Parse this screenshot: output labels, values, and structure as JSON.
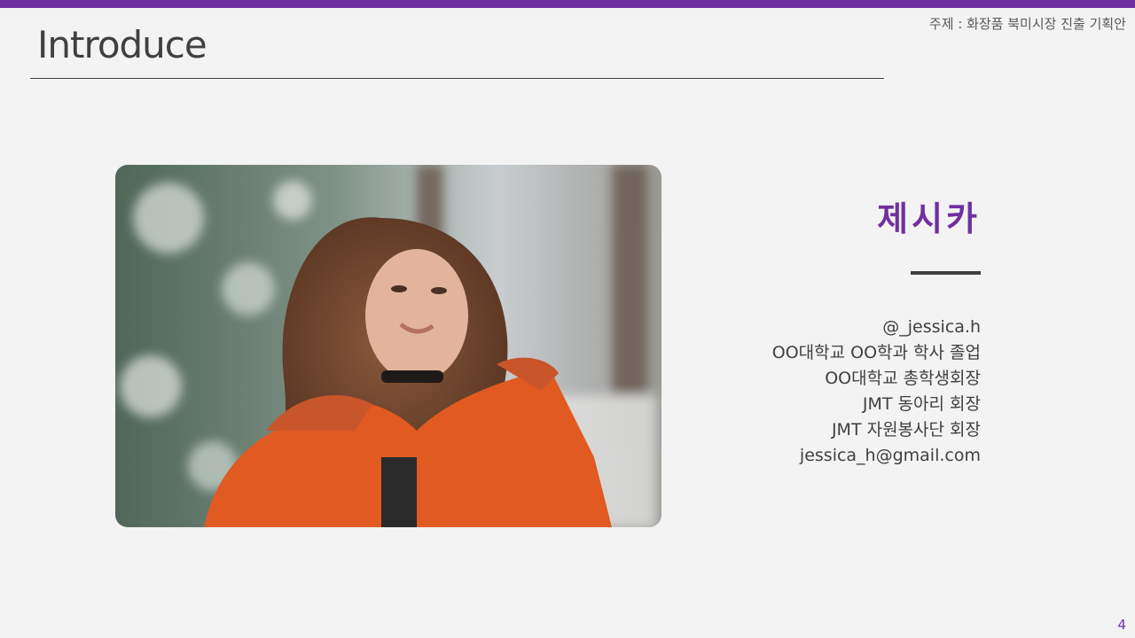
{
  "slide": {
    "topic": "주제 : 화장품 북미시장 진출 기획안",
    "title": "Introduce",
    "page_number": "4"
  },
  "profile": {
    "name": "제시카",
    "details": [
      "@_jessica.h",
      "OO대학교 OO학과 학사 졸업",
      "OO대학교 총학생회장",
      "JMT 동아리 회장",
      "JMT 자원봉사단 회장",
      "jessica_h@gmail.com"
    ]
  },
  "colors": {
    "accent": "#7030a0",
    "text": "#404040",
    "background": "#f3f3f3"
  }
}
